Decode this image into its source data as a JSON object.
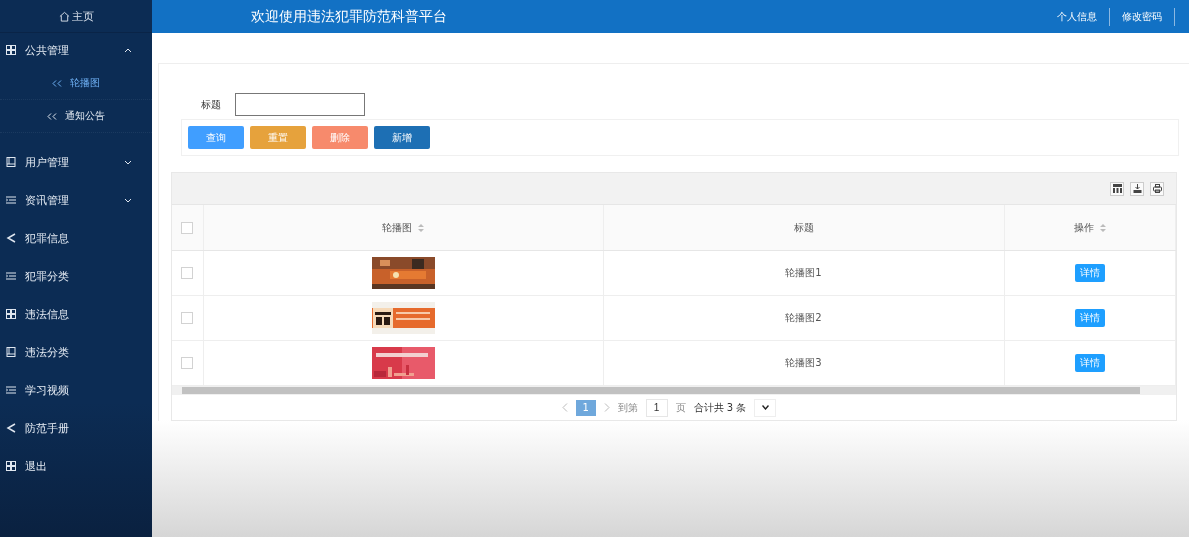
{
  "sidebar": {
    "home": "主页",
    "items": [
      {
        "kind": "group",
        "label": "公共管理",
        "expanded": true,
        "children": [
          {
            "label": "轮播图",
            "selected": true
          },
          {
            "label": "通知公告",
            "selected": false
          }
        ]
      },
      {
        "kind": "group",
        "label": "用户管理",
        "expanded": false
      },
      {
        "kind": "group",
        "label": "资讯管理",
        "expanded": false
      },
      {
        "kind": "link",
        "label": "犯罪信息"
      },
      {
        "kind": "link",
        "label": "犯罪分类"
      },
      {
        "kind": "link",
        "label": "违法信息"
      },
      {
        "kind": "link",
        "label": "违法分类"
      },
      {
        "kind": "link",
        "label": "学习视频"
      },
      {
        "kind": "link",
        "label": "防范手册"
      },
      {
        "kind": "link",
        "label": "退出"
      }
    ]
  },
  "header": {
    "title": "欢迎使用违法犯罪防范科普平台",
    "links": [
      "个人信息",
      "修改密码"
    ]
  },
  "filter": {
    "label": "标题"
  },
  "buttons": [
    {
      "label": "查询",
      "color": "#409eff"
    },
    {
      "label": "重置",
      "color": "#e6a23c"
    },
    {
      "label": "删除",
      "color": "#f78a6c"
    },
    {
      "label": "新增",
      "color": "#1d6fb4"
    }
  ],
  "table": {
    "select_all": {
      "checked": false
    },
    "columns": [
      {
        "label": "轮播图",
        "sortable": true
      },
      {
        "label": "标题",
        "sortable": false
      },
      {
        "label": "操作",
        "sortable": true
      }
    ],
    "rows": [
      {
        "checked": false,
        "title": "轮播图1",
        "action": "详情"
      },
      {
        "checked": false,
        "title": "轮播图2",
        "action": "详情"
      },
      {
        "checked": false,
        "title": "轮播图3",
        "action": "详情"
      }
    ]
  },
  "pagination": {
    "pages": [
      {
        "label": "1",
        "selected": true
      }
    ],
    "goto_label": "到第",
    "goto_value": "1",
    "page_unit": "页",
    "total": "合计共 3 条"
  }
}
